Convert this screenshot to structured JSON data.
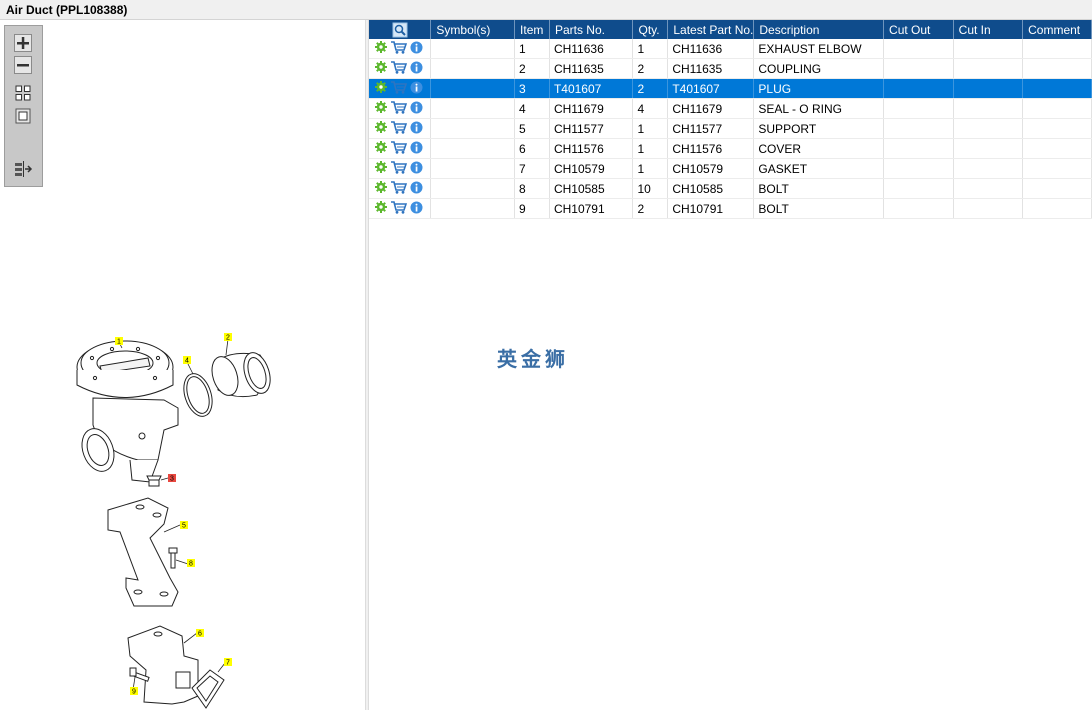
{
  "window": {
    "title": "Air Duct (PPL108388)"
  },
  "toolbar": {
    "zoom_in": "zoom-in-icon",
    "zoom_out": "zoom-out-icon",
    "fit_all": "fit-all-icon",
    "fit_window": "fit-window-icon",
    "list_toggle": "list-toggle-icon"
  },
  "table": {
    "headers": [
      "Symbol(s)",
      "Item",
      "Parts No.",
      "Qty.",
      "Latest Part No.",
      "Description",
      "Cut Out",
      "Cut In",
      "Comment"
    ],
    "rows": [
      {
        "symbol": "",
        "item": "1",
        "parts_no": "CH11636",
        "qty": "1",
        "latest": "CH11636",
        "desc": "EXHAUST ELBOW",
        "cut_out": "",
        "cut_in": "",
        "comment": ""
      },
      {
        "symbol": "",
        "item": "2",
        "parts_no": "CH11635",
        "qty": "2",
        "latest": "CH11635",
        "desc": "COUPLING",
        "cut_out": "",
        "cut_in": "",
        "comment": ""
      },
      {
        "symbol": "",
        "item": "3",
        "parts_no": "T401607",
        "qty": "2",
        "latest": "T401607",
        "desc": "PLUG",
        "cut_out": "",
        "cut_in": "",
        "comment": ""
      },
      {
        "symbol": "",
        "item": "4",
        "parts_no": "CH11679",
        "qty": "4",
        "latest": "CH11679",
        "desc": "SEAL - O RING",
        "cut_out": "",
        "cut_in": "",
        "comment": ""
      },
      {
        "symbol": "",
        "item": "5",
        "parts_no": "CH11577",
        "qty": "1",
        "latest": "CH11577",
        "desc": "SUPPORT",
        "cut_out": "",
        "cut_in": "",
        "comment": ""
      },
      {
        "symbol": "",
        "item": "6",
        "parts_no": "CH11576",
        "qty": "1",
        "latest": "CH11576",
        "desc": "COVER",
        "cut_out": "",
        "cut_in": "",
        "comment": ""
      },
      {
        "symbol": "",
        "item": "7",
        "parts_no": "CH10579",
        "qty": "1",
        "latest": "CH10579",
        "desc": "GASKET",
        "cut_out": "",
        "cut_in": "",
        "comment": ""
      },
      {
        "symbol": "",
        "item": "8",
        "parts_no": "CH10585",
        "qty": "10",
        "latest": "CH10585",
        "desc": "BOLT",
        "cut_out": "",
        "cut_in": "",
        "comment": ""
      },
      {
        "symbol": "",
        "item": "9",
        "parts_no": "CH10791",
        "qty": "2",
        "latest": "CH10791",
        "desc": "BOLT",
        "cut_out": "",
        "cut_in": "",
        "comment": ""
      }
    ],
    "selected_row": 2
  },
  "diagram": {
    "callouts": [
      "1",
      "2",
      "3",
      "4",
      "5",
      "6",
      "7",
      "8",
      "9"
    ],
    "highlighted_callout": "3",
    "highlight_color": "#e8473f",
    "callout_color": "#ffff00"
  },
  "watermark": {
    "text": "英金狮"
  },
  "colors": {
    "header_bg": "#0f4c8c",
    "selected_bg": "#0078d7",
    "gear_green": "#5cb82d",
    "cart_blue": "#2f74c0",
    "info_blue": "#3d8fe0"
  }
}
